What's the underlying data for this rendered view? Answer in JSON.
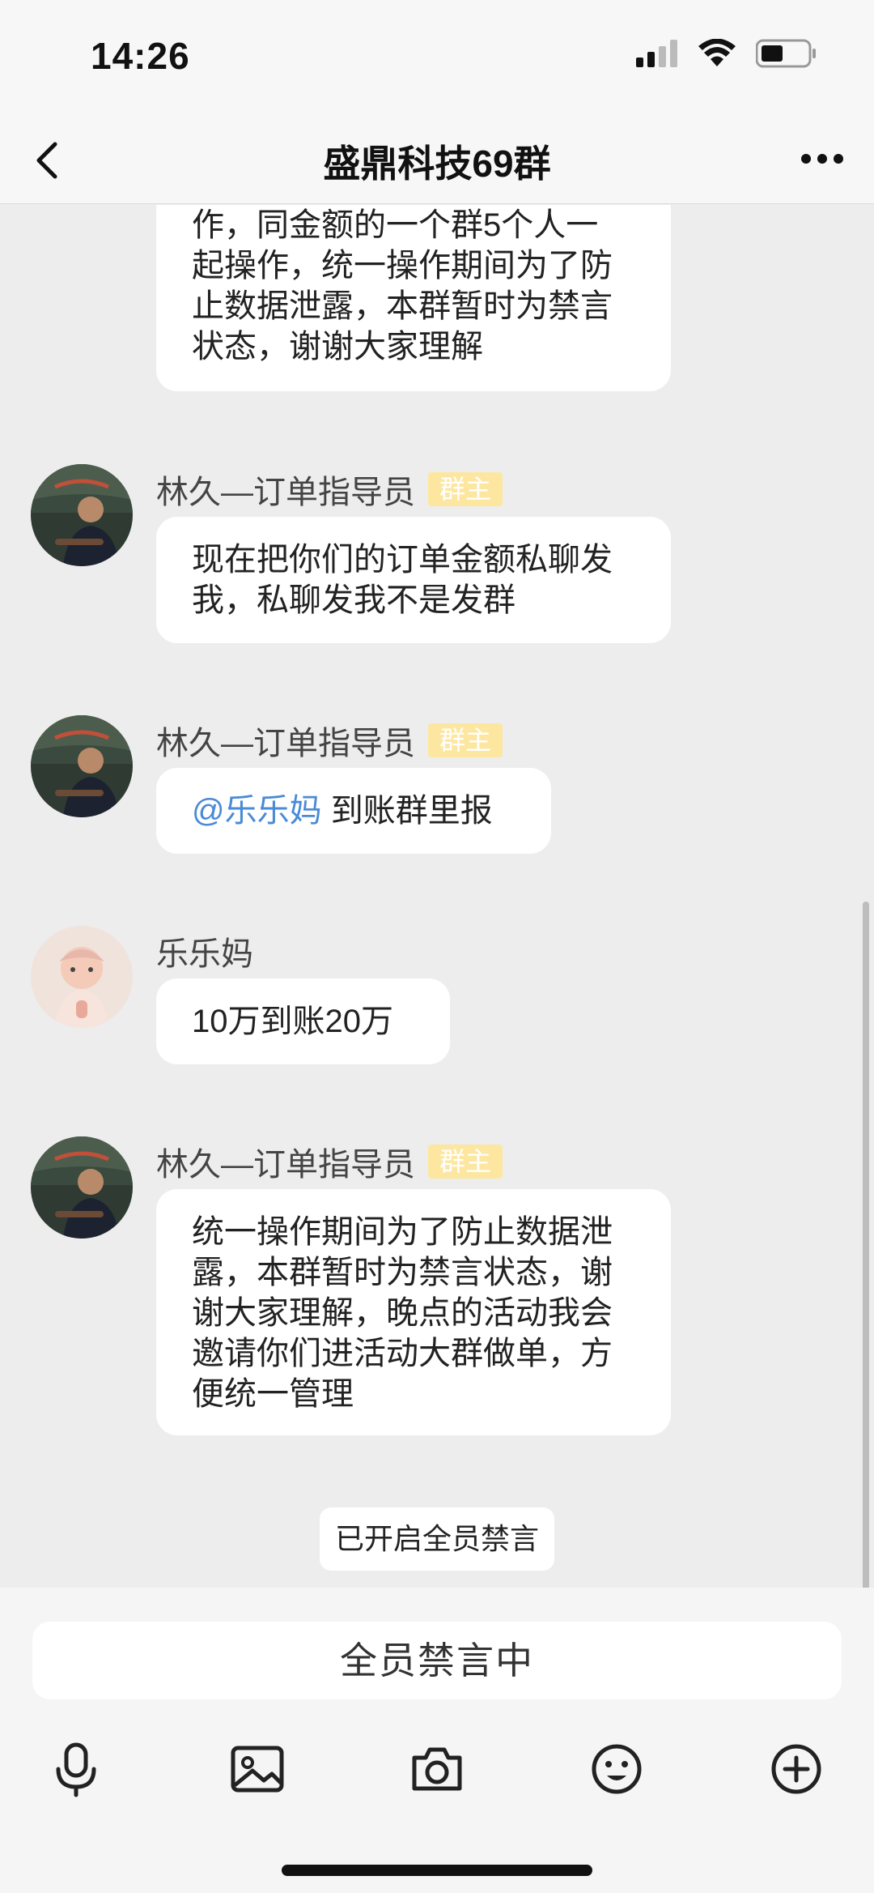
{
  "status": {
    "time": "14:26"
  },
  "header": {
    "title": "盛鼎科技69群"
  },
  "messages": [
    {
      "lines": [
        "作，同金额的一个群5个人一",
        "起操作，统一操作期间为了防",
        "止数据泄露，本群暂时为禁言",
        "状态，谢谢大家理解"
      ]
    },
    {
      "sender": "林久—订单指导员",
      "badge": "群主",
      "lines": [
        "现在把你们的订单金额私聊发",
        "我，私聊发我不是发群"
      ]
    },
    {
      "sender": "林久—订单指导员",
      "badge": "群主",
      "mention": "@乐乐妈",
      "text": " 到账群里报"
    },
    {
      "sender": "乐乐妈",
      "text": "10万到账20万"
    },
    {
      "sender": "林久—订单指导员",
      "badge": "群主",
      "lines": [
        "统一操作期间为了防止数据泄",
        "露，本群暂时为禁言状态，谢",
        "谢大家理解，晚点的活动我会",
        "邀请你们进活动大群做单，方",
        "便统一管理"
      ]
    }
  ],
  "system_notice": "已开启全员禁言",
  "input": {
    "muted_label": "全员禁言中"
  },
  "toolbar": [
    "microphone-icon",
    "image-icon",
    "camera-icon",
    "emoji-icon",
    "plus-icon"
  ],
  "colors": {
    "mention": "#4a8ad6",
    "badge_bg": "#fde7a0",
    "chat_bg": "#ededed"
  }
}
